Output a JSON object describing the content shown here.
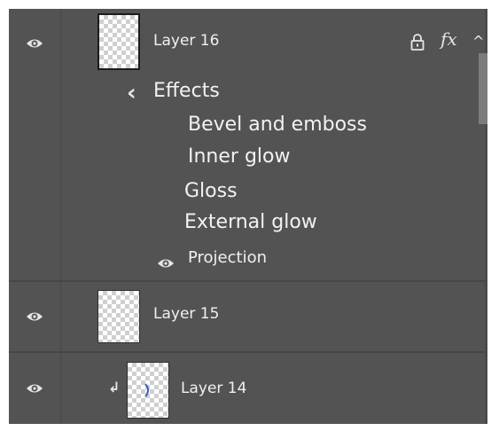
{
  "layers": [
    {
      "name": "Layer 16",
      "visible": true,
      "locked": true,
      "has_effects": true,
      "expanded": true,
      "effects_heading": "Effects",
      "effects": [
        "Bevel and emboss",
        "Inner glow",
        "Gloss",
        "External glow"
      ],
      "projection": {
        "label": "Projection",
        "visible": true
      }
    },
    {
      "name": "Layer 15",
      "visible": true
    },
    {
      "name": "Layer 14",
      "visible": true,
      "clipped": true
    }
  ],
  "icons": {
    "fx": "fx",
    "collapse": "^",
    "effects_toggle": "‹",
    "clip_arrow": "↲",
    "lock": "lock-icon",
    "eye": "eye-icon"
  },
  "colors": {
    "panel_bg": "#535353",
    "separator": "#464646",
    "text": "#f0f0f0"
  }
}
